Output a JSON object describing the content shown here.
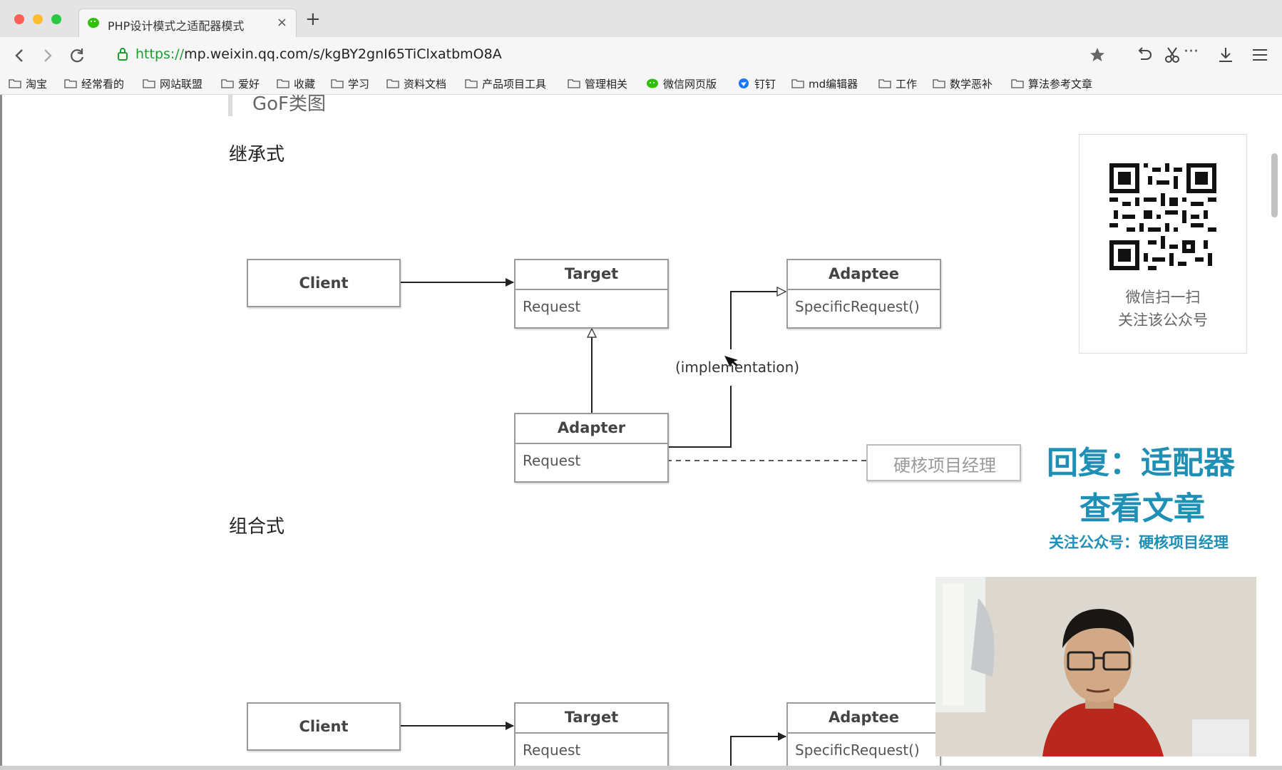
{
  "browser": {
    "tab_title": "PHP设计模式之适配器模式",
    "tab_close": "×",
    "new_tab": "+",
    "url_scheme": "https://",
    "url_rest": "mp.weixin.qq.com/s/kgBY2gnI65TiClxatbmO8A",
    "more_dots": "···",
    "bookmarks": [
      "淘宝",
      "经常看的",
      "网站联盟",
      "爱好",
      "收藏",
      "学习",
      "资料文档",
      "产品项目工具",
      "管理相关",
      "微信网页版",
      "钉钉",
      "md编辑器",
      "工作",
      "数学恶补",
      "算法参考文章"
    ]
  },
  "article": {
    "gof_heading": "GoF类图",
    "section_inheritance": "继承式",
    "section_composition": "组合式",
    "diagram1": {
      "client": "Client",
      "target": "Target",
      "target_op": "Request",
      "adaptee": "Adaptee",
      "adaptee_op": "SpecificRequest()",
      "adapter": "Adapter",
      "adapter_op": "Request",
      "edge_label": "(implementation)",
      "note": "硬核项目经理"
    },
    "diagram2": {
      "client": "Client",
      "target": "Target",
      "target_op": "Request",
      "adaptee": "Adaptee",
      "adaptee_op": "SpecificRequest()"
    }
  },
  "qr": {
    "caption_line1": "微信扫一扫",
    "caption_line2": "关注该公众号"
  },
  "promo": {
    "line1": "回复：适配器",
    "line2": "查看文章",
    "line3": "关注公众号：硬核项目经理"
  },
  "colors": {
    "accent": "#1e8fb5",
    "url_green": "#1c9e2e",
    "wechat_green": "#2dc100"
  }
}
